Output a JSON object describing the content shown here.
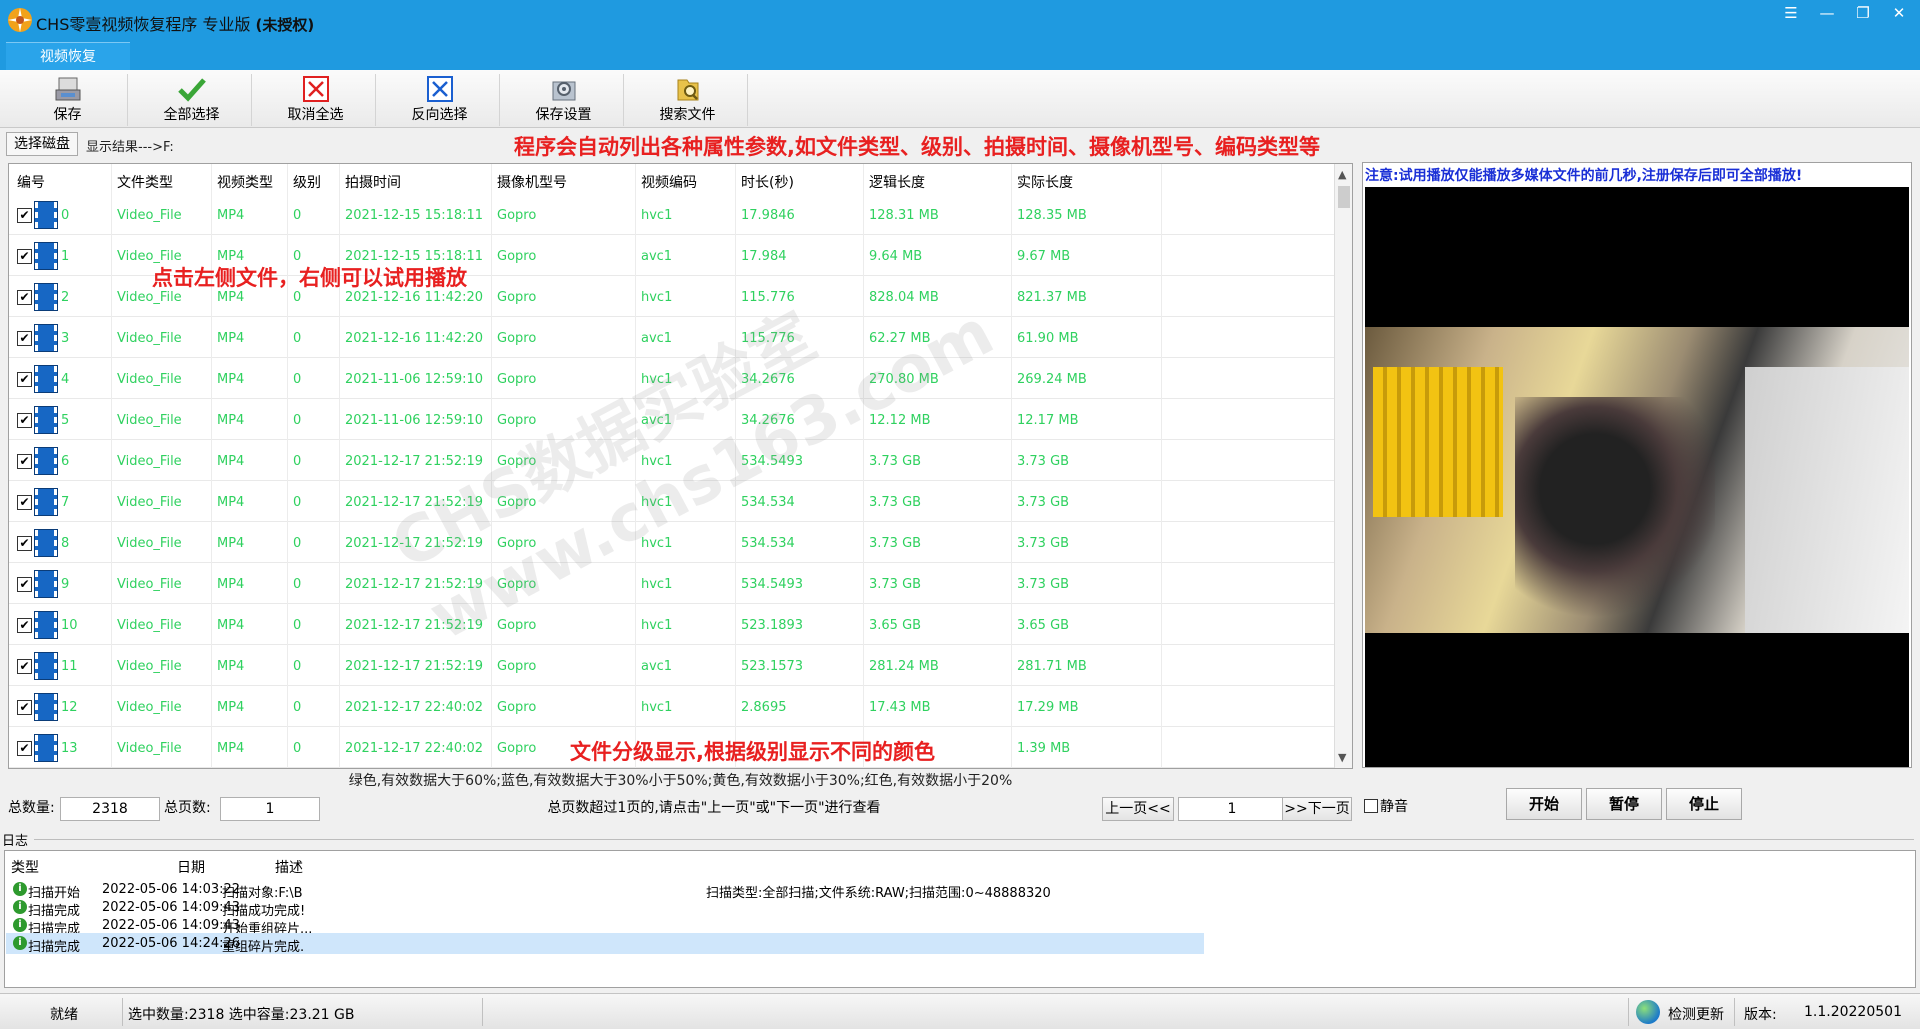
{
  "app": {
    "title": "CHS零壹视频恢复程序 专业版",
    "title_suffix": "(未授权)",
    "window_buttons": [
      "☰",
      "—",
      "❐",
      "✕"
    ]
  },
  "ribbon": {
    "tab": "视频恢复"
  },
  "toolbar": {
    "items": [
      {
        "label": "保存",
        "icon": "save-icon"
      },
      {
        "label": "全部选择",
        "icon": "checkmark-icon"
      },
      {
        "label": "取消全选",
        "icon": "red-x-box-icon"
      },
      {
        "label": "反向选择",
        "icon": "blue-x-box-icon"
      },
      {
        "label": "保存设置",
        "icon": "settings-folder-icon"
      },
      {
        "label": "搜索文件",
        "icon": "search-folder-icon"
      }
    ]
  },
  "disk": {
    "select_label": "选择磁盘",
    "result_path": "显示结果--->F:"
  },
  "annotations": {
    "top": "程序会自动列出各种属性参数,如文件类型、级别、拍摄时间、摄像机型号、编码类型等",
    "middle": "点击左侧文件，右侧可以试用播放",
    "bottom": "文件分级显示,根据级别显示不同的颜色"
  },
  "table": {
    "columns": [
      "编号",
      "文件类型",
      "视频类型",
      "级别",
      "拍摄时间",
      "摄像机型号",
      "视频编码",
      "时长(秒)",
      "逻辑长度",
      "实际长度"
    ],
    "rows": [
      [
        "0",
        "Video_File",
        "MP4",
        "0",
        "2021-12-15 15:18:11",
        "Gopro",
        "hvc1",
        "17.9846",
        "128.31 MB",
        "128.35 MB"
      ],
      [
        "1",
        "Video_File",
        "MP4",
        "0",
        "2021-12-15 15:18:11",
        "Gopro",
        "avc1",
        "17.984",
        "9.64 MB",
        "9.67 MB"
      ],
      [
        "2",
        "Video_File",
        "MP4",
        "0",
        "2021-12-16 11:42:20",
        "Gopro",
        "hvc1",
        "115.776",
        "828.04 MB",
        "821.37 MB"
      ],
      [
        "3",
        "Video_File",
        "MP4",
        "0",
        "2021-12-16 11:42:20",
        "Gopro",
        "avc1",
        "115.776",
        "62.27 MB",
        "61.90 MB"
      ],
      [
        "4",
        "Video_File",
        "MP4",
        "0",
        "2021-11-06 12:59:10",
        "Gopro",
        "hvc1",
        "34.2676",
        "270.80 MB",
        "269.24 MB"
      ],
      [
        "5",
        "Video_File",
        "MP4",
        "0",
        "2021-11-06 12:59:10",
        "Gopro",
        "avc1",
        "34.2676",
        "12.12 MB",
        "12.17 MB"
      ],
      [
        "6",
        "Video_File",
        "MP4",
        "0",
        "2021-12-17 21:52:19",
        "Gopro",
        "hvc1",
        "534.5493",
        "3.73 GB",
        "3.73 GB"
      ],
      [
        "7",
        "Video_File",
        "MP4",
        "0",
        "2021-12-17 21:52:19",
        "Gopro",
        "hvc1",
        "534.534",
        "3.73 GB",
        "3.73 GB"
      ],
      [
        "8",
        "Video_File",
        "MP4",
        "0",
        "2021-12-17 21:52:19",
        "Gopro",
        "hvc1",
        "534.534",
        "3.73 GB",
        "3.73 GB"
      ],
      [
        "9",
        "Video_File",
        "MP4",
        "0",
        "2021-12-17 21:52:19",
        "Gopro",
        "hvc1",
        "534.5493",
        "3.73 GB",
        "3.73 GB"
      ],
      [
        "10",
        "Video_File",
        "MP4",
        "0",
        "2021-12-17 21:52:19",
        "Gopro",
        "hvc1",
        "523.1893",
        "3.65 GB",
        "3.65 GB"
      ],
      [
        "11",
        "Video_File",
        "MP4",
        "0",
        "2021-12-17 21:52:19",
        "Gopro",
        "avc1",
        "523.1573",
        "281.24 MB",
        "281.71 MB"
      ],
      [
        "12",
        "Video_File",
        "MP4",
        "0",
        "2021-12-17 22:40:02",
        "Gopro",
        "hvc1",
        "2.8695",
        "17.43 MB",
        "17.29 MB"
      ],
      [
        "13",
        "Video_File",
        "MP4",
        "0",
        "2021-12-17 22:40:02",
        "Gopro",
        "",
        "",
        "",
        "1.39 MB"
      ]
    ],
    "row_color": "#2fd15f"
  },
  "legend_text": "绿色,有效数据大于60%;蓝色,有效数据大于30%小于50%;黄色,有效数据小于30%;红色,有效数据小于20%",
  "pager": {
    "total_label": "总数量:",
    "total_value": "2318",
    "pages_label": "总页数:",
    "pages_value": "1",
    "hint": "总页数超过1页的,请点击\"上一页\"或\"下一页\"进行查看",
    "prev": "上一页<<",
    "current": "1",
    "next": ">>下一页"
  },
  "preview": {
    "note": "注意:试用播放仅能播放多媒体文件的前几秒,注册保存后即可全部播放!",
    "mute_label": "静音",
    "start": "开始",
    "pause": "暂停",
    "stop": "停止"
  },
  "log": {
    "label": "日志",
    "columns": [
      "类型",
      "日期",
      "描述"
    ],
    "rows": [
      [
        "扫描开始",
        "2022-05-06 14:03:22",
        "扫描对象:F:\\B",
        "扫描类型:全部扫描;文件系统:RAW;扫描范围:0~48888320"
      ],
      [
        "扫描完成",
        "2022-05-06 14:09:43",
        "扫描成功完成!",
        ""
      ],
      [
        "扫描完成",
        "2022-05-06 14:09:43",
        "开始重组碎片...",
        ""
      ],
      [
        "扫描完成",
        "2022-05-06 14:24:26",
        "重组碎片完成.",
        ""
      ]
    ]
  },
  "status": {
    "ready": "就绪",
    "selection": "选中数量:2318 选中容量:23.21 GB",
    "check_update": "检测更新",
    "version_label": "版本:",
    "version": "1.1.20220501"
  },
  "watermark": {
    "line1": "CHS数据实验室",
    "line2": "www.chs163.com"
  }
}
